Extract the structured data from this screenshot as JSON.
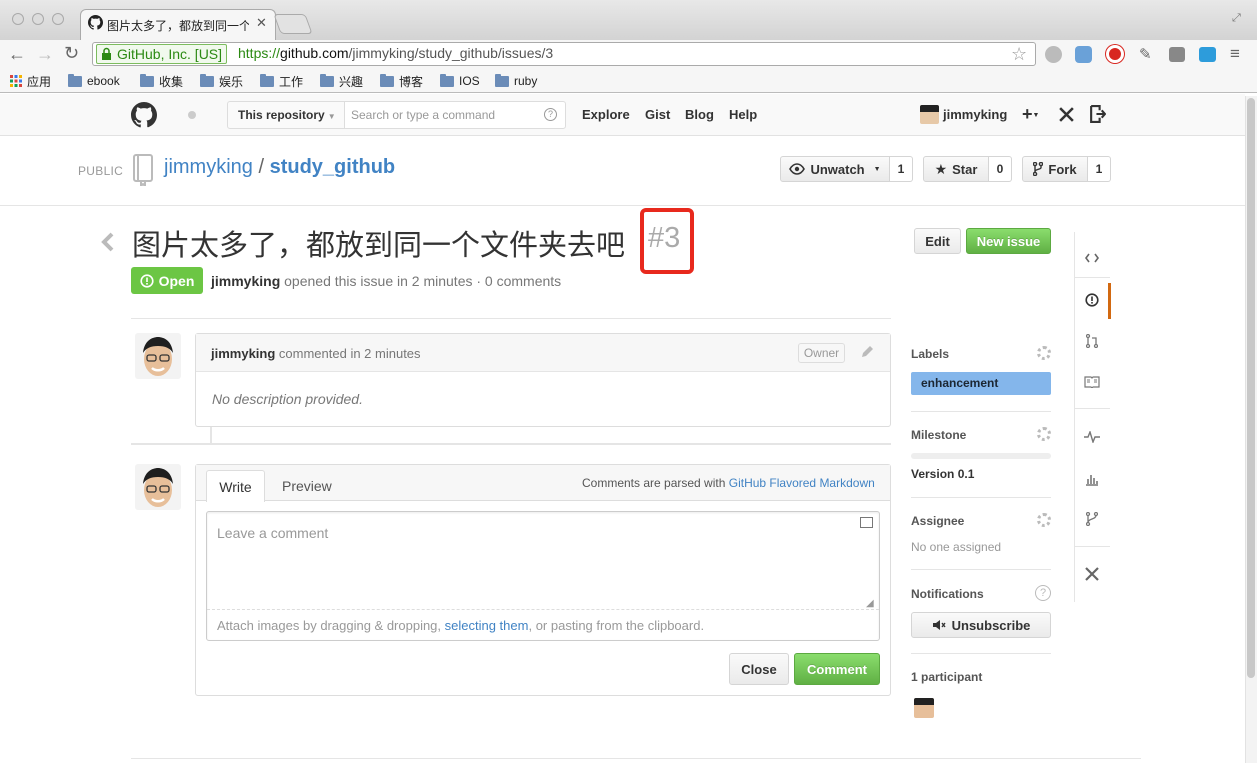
{
  "browser": {
    "tab_title": "图片太多了，都放到同一个文",
    "ev_label": "GitHub, Inc. [US]",
    "url_scheme": "https://",
    "url_host": "github.com",
    "url_path": "/jimmyking/study_github/issues/3",
    "bookmarks": [
      {
        "label": "应用",
        "icon": "apps-grid-icon"
      },
      {
        "label": "ebook",
        "icon": "folder-icon"
      },
      {
        "label": "收集",
        "icon": "folder-icon"
      },
      {
        "label": "娱乐",
        "icon": "folder-icon"
      },
      {
        "label": "工作",
        "icon": "folder-icon"
      },
      {
        "label": "兴趣",
        "icon": "folder-icon"
      },
      {
        "label": "博客",
        "icon": "folder-icon"
      },
      {
        "label": "IOS",
        "icon": "folder-icon"
      },
      {
        "label": "ruby",
        "icon": "folder-icon"
      }
    ]
  },
  "header": {
    "scope": "This repository",
    "search_placeholder": "Search or type a command",
    "nav": [
      "Explore",
      "Gist",
      "Blog",
      "Help"
    ],
    "username": "jimmyking",
    "plus": "+"
  },
  "repo": {
    "visibility": "PUBLIC",
    "owner": "jimmyking",
    "separator": " / ",
    "name": "study_github",
    "unwatch_label": "Unwatch",
    "unwatch_count": "1",
    "star_label": "Star",
    "star_count": "0",
    "fork_label": "Fork",
    "fork_count": "1"
  },
  "issue": {
    "title": "图片太多了，都放到同一个文件夹去吧",
    "number": "#3",
    "edit_label": "Edit",
    "new_issue_label": "New issue",
    "state": "Open",
    "author": "jimmyking",
    "meta_text": " opened this issue in 2 minutes · 0 comments"
  },
  "comment": {
    "author": "jimmyking",
    "time_text": " commented in 2 minutes",
    "owner_badge": "Owner",
    "body": "No description provided."
  },
  "composer": {
    "tab_write": "Write",
    "tab_preview": "Preview",
    "markdown_note": "Comments are parsed with ",
    "markdown_link": "GitHub Flavored Markdown",
    "placeholder": "Leave a comment",
    "attach_text_1": "Attach images by dragging & dropping, ",
    "attach_link": "selecting them",
    "attach_text_2": ", or pasting from the clipboard.",
    "close_label": "Close",
    "comment_label": "Comment"
  },
  "sidebar": {
    "labels_heading": "Labels",
    "label": "enhancement",
    "label_color": "#84b6eb",
    "milestone_heading": "Milestone",
    "milestone": "Version 0.1",
    "assignee_heading": "Assignee",
    "assignee": "No one assigned",
    "notifications_heading": "Notifications",
    "unsubscribe_label": "Unsubscribe",
    "participants": "1 participant"
  },
  "colors": {
    "accent": "#4183c4",
    "open_green": "#6cc644",
    "highlight_red": "#e8291d"
  }
}
